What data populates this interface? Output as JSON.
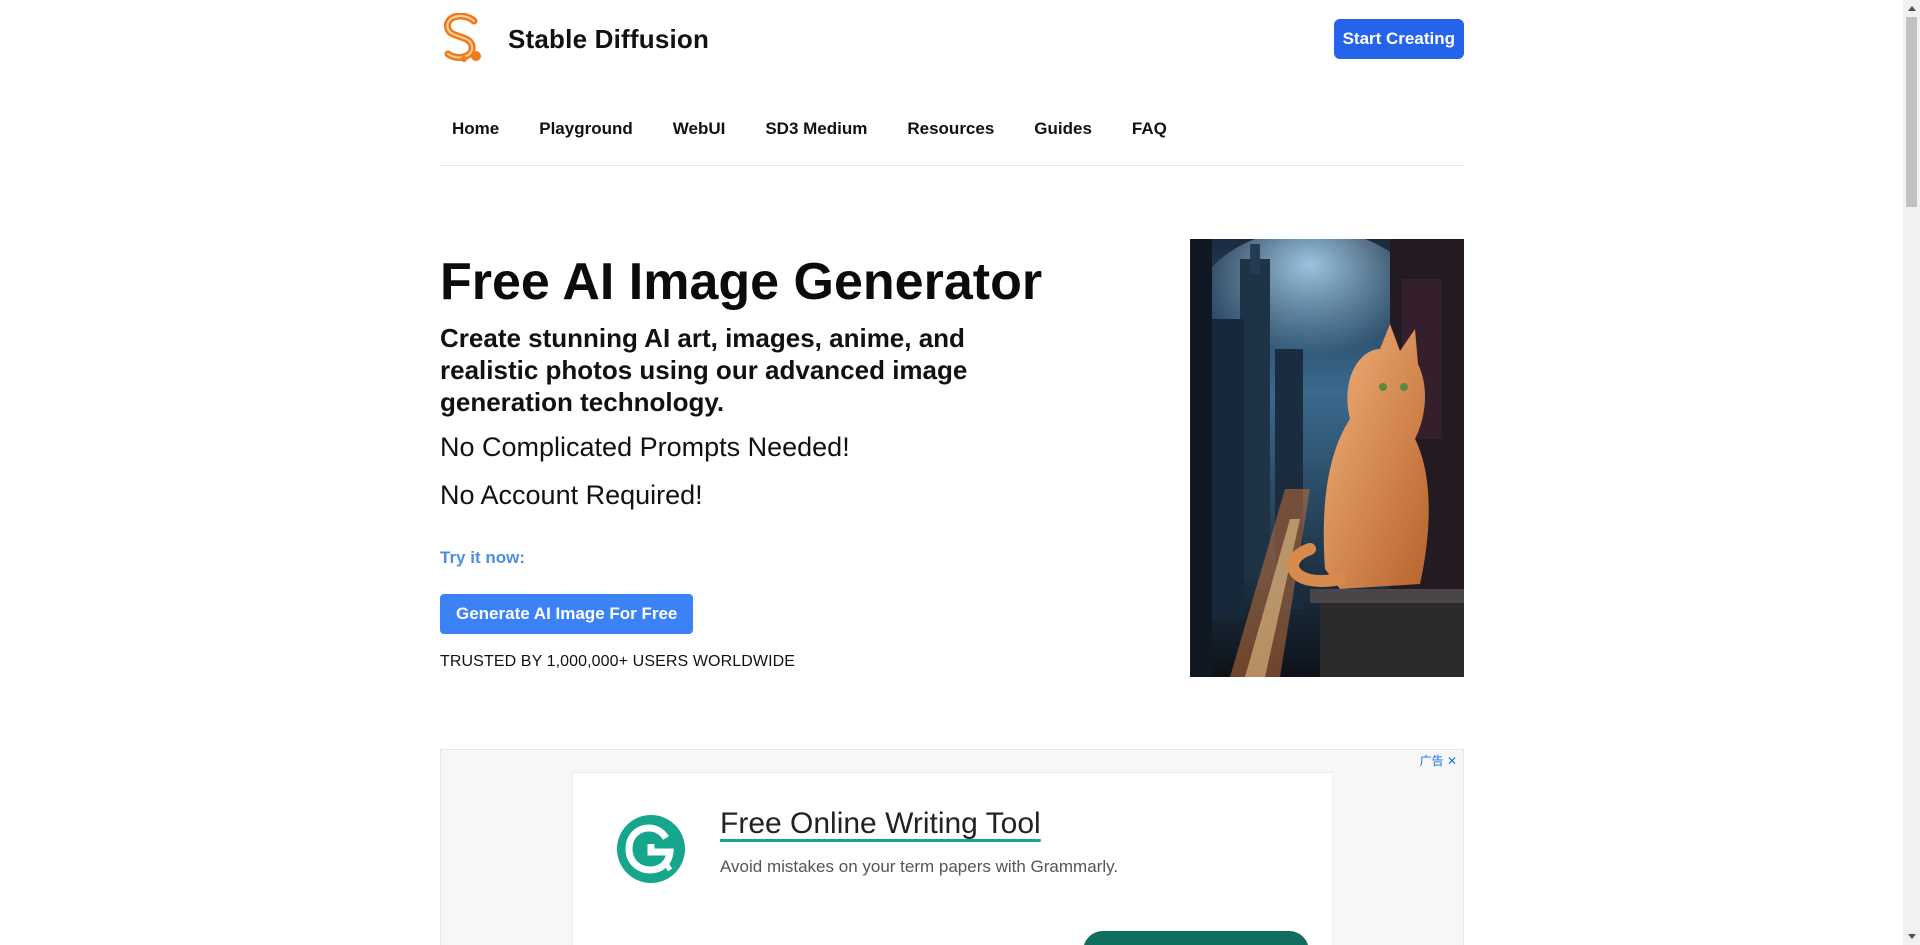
{
  "header": {
    "brand": "Stable Diffusion",
    "start_label": "Start Creating",
    "logo_icon": "stable-diffusion-s-logo-icon",
    "accent": "#2563eb",
    "logo_color": "#f07a1a"
  },
  "nav": {
    "items": [
      {
        "label": "Home"
      },
      {
        "label": "Playground"
      },
      {
        "label": "WebUI"
      },
      {
        "label": "SD3 Medium"
      },
      {
        "label": "Resources"
      },
      {
        "label": "Guides"
      },
      {
        "label": "FAQ"
      }
    ]
  },
  "hero": {
    "title": "Free AI Image Generator",
    "subtitle": "Create stunning AI art, images, anime, and realistic photos using our advanced image generation technology.",
    "line1": "No Complicated Prompts Needed!",
    "line2": "No Account Required!",
    "try_label": "Try it now:",
    "generate_label": "Generate AI Image For Free",
    "trusted": "TRUSTED BY 1,000,000+ USERS WORLDWIDE",
    "image_icon": "orange-cat-city-image",
    "try_color": "#4a90e2",
    "button_color": "#3b82f6"
  },
  "ad": {
    "marker": "广告 ✕",
    "title": "Free Online Writing Tool",
    "description": "Avoid mistakes on your term papers with Grammarly.",
    "logo_icon": "grammarly-g-icon",
    "brand_color": "#15a68b"
  }
}
